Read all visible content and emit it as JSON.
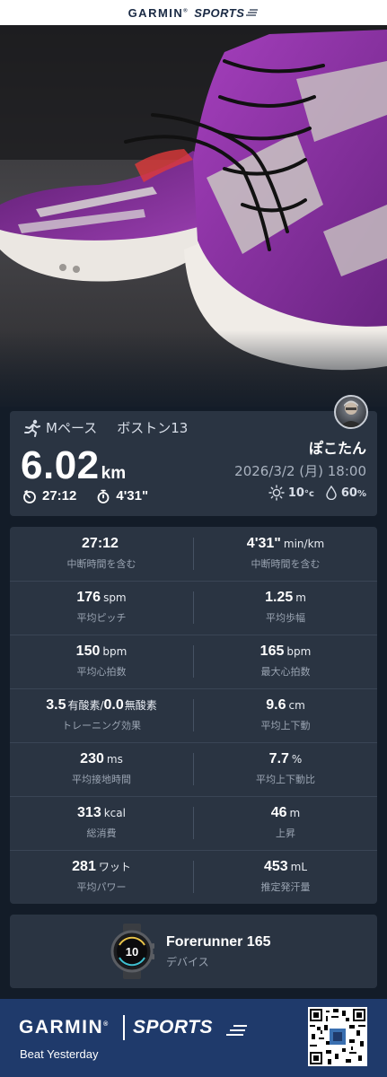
{
  "header": {
    "brand": "GARMIN",
    "brand_mark": "®",
    "sports": "SPORTS"
  },
  "activity": {
    "type_label": "Mペース",
    "title": "ボストン13",
    "distance": "6.02",
    "distance_unit": "km",
    "duration": "27:12",
    "pace": "4'31\"",
    "user": "ぽこたん",
    "datetime": "2026/3/2 (月) 18:00",
    "temperature": "10",
    "temperature_unit": "°c",
    "humidity": "60",
    "humidity_unit": "%",
    "icons": [
      "runner-icon",
      "timer-icon",
      "stopwatch-icon",
      "sun-icon",
      "droplet-icon"
    ]
  },
  "stats": [
    {
      "left": {
        "value": "27:12",
        "unit": "",
        "caption": "中断時間を含む"
      },
      "right": {
        "value": "4'31\"",
        "unit": "min/km",
        "caption": "中断時間を含む"
      }
    },
    {
      "left": {
        "value": "176",
        "unit": "spm",
        "caption": "平均ピッチ"
      },
      "right": {
        "value": "1.25",
        "unit": "m",
        "caption": "平均歩幅"
      }
    },
    {
      "left": {
        "value": "150",
        "unit": "bpm",
        "caption": "平均心拍数"
      },
      "right": {
        "value": "165",
        "unit": "bpm",
        "caption": "最大心拍数"
      }
    },
    {
      "left": {
        "value": "3.5",
        "unit": "有酸素/",
        "value2": "0.0",
        "unit2": "無酸素",
        "caption": "トレーニング効果"
      },
      "right": {
        "value": "9.6",
        "unit": "cm",
        "caption": "平均上下動"
      }
    },
    {
      "left": {
        "value": "230",
        "unit": "ms",
        "caption": "平均接地時間"
      },
      "right": {
        "value": "7.7",
        "unit": "%",
        "caption": "平均上下動比"
      }
    },
    {
      "left": {
        "value": "313",
        "unit": "kcal",
        "caption": "総消費"
      },
      "right": {
        "value": "46",
        "unit": "m",
        "caption": "上昇"
      }
    },
    {
      "left": {
        "value": "281",
        "unit": "ワット",
        "caption": "平均パワー"
      },
      "right": {
        "value": "453",
        "unit": "mL",
        "caption": "推定発汗量"
      }
    }
  ],
  "device": {
    "name": "Forerunner 165",
    "label": "デバイス",
    "watch_time": "10"
  },
  "footer": {
    "brand": "GARMIN",
    "brand_mark": "®",
    "sports": "SPORTS",
    "tagline": "Beat Yesterday"
  },
  "colors": {
    "background": "#131c28",
    "card": "#2a3442",
    "footer": "#1f3a6b",
    "shoe_purple": "#7a2b8c"
  }
}
